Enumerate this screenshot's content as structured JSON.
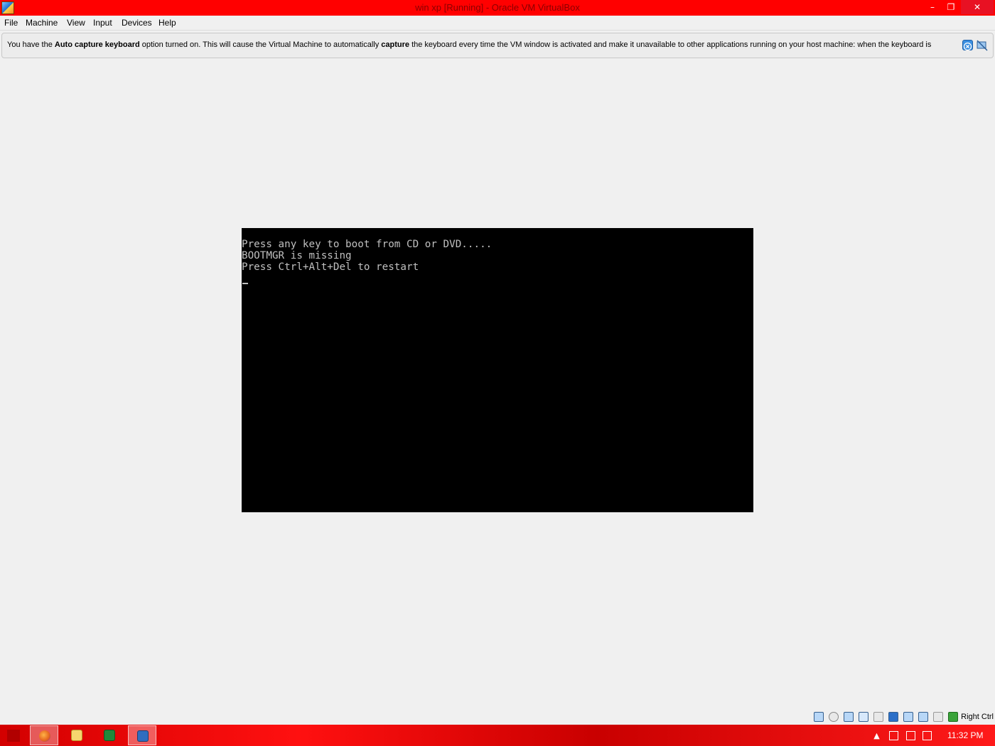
{
  "window": {
    "title": "win xp [Running] - Oracle VM VirtualBox",
    "minimize_glyph": "–",
    "restore_glyph": "❐",
    "close_glyph": "✕"
  },
  "menu": {
    "items": [
      "File",
      "Machine",
      "View",
      "Input",
      "Devices",
      "Help"
    ]
  },
  "notice": {
    "text_1": "You have the ",
    "bold_1": "Auto capture keyboard",
    "text_2": " option turned on. This will cause the Virtual Machine to automatically ",
    "bold_2": "capture",
    "text_3": " the keyboard every time the VM window is activated and make it unavailable to other applications running on your host machine: when the keyboard is",
    "icons": [
      "info-close-icon",
      "do-not-show-again-icon"
    ]
  },
  "vm_console": {
    "lines": [
      "Press any key to boot from CD or DVD.....",
      "BOOTMGR is missing",
      "Press Ctrl+Alt+Del to restart"
    ]
  },
  "statusbar": {
    "icons": [
      "hard-disk-icon",
      "optical-drive-icon",
      "network-icon",
      "usb-icon",
      "shared-folders-icon",
      "display-icon",
      "video-capture-icon",
      "mouse-integration-icon",
      "guest-additions-icon",
      "host-key-icon"
    ],
    "host_key": "Right Ctrl"
  },
  "taskbar": {
    "apps": [
      "firefox-icon",
      "file-explorer-icon",
      "excel-icon",
      "virtualbox-icon"
    ],
    "tray_icons": [
      "show-hidden-icons-icon",
      "action-center-flag-icon",
      "network-tray-icon",
      "volume-muted-icon"
    ],
    "show_hidden_glyph": "▲",
    "clock": "11:32 PM"
  }
}
